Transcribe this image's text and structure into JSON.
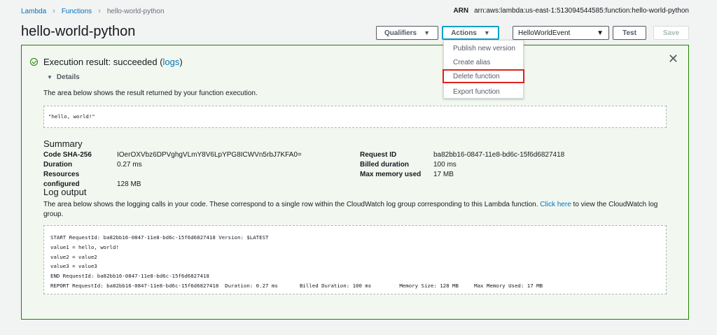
{
  "breadcrumb": [
    "Lambda",
    "Functions",
    "hello-world-python"
  ],
  "arn": {
    "label": "ARN",
    "value": "arn:aws:lambda:us-east-1:513094544585:function:hello-world-python"
  },
  "title": "hello-world-python",
  "header": {
    "qualifiers_label": "Qualifiers",
    "actions_label": "Actions",
    "event_selected": "HelloWorldEvent",
    "test_label": "Test",
    "save_label": "Save"
  },
  "actions_menu": [
    "Publish new version",
    "Create alias",
    "Delete function",
    "Export function"
  ],
  "result": {
    "heading_prefix": "Execution result: succeeded (",
    "logs_link": "logs",
    "heading_suffix": ")",
    "details_label": "Details",
    "description": "The area below shows the result returned by your function execution.",
    "output": "\"hello, world!\""
  },
  "summary": {
    "title": "Summary",
    "left": [
      {
        "k": "Code SHA-256",
        "v": "IOerOXVbz6DPVghgVLmY8V6LpYPG8ICWVn5rbJ7KFA0="
      },
      {
        "k": "Duration",
        "v": "0.27 ms"
      },
      {
        "k": "Resources configured",
        "v": "128 MB"
      }
    ],
    "right": [
      {
        "k": "Request ID",
        "v": "ba82bb16-0847-11e8-bd6c-15f6d6827418"
      },
      {
        "k": "Billed duration",
        "v": "100 ms"
      },
      {
        "k": "Max memory used",
        "v": "17 MB"
      }
    ]
  },
  "log": {
    "title": "Log output",
    "desc_prefix": "The area below shows the logging calls in your code. These correspond to a single row within the CloudWatch log group corresponding to this Lambda function. ",
    "click_here": "Click here",
    "desc_suffix": " to view the CloudWatch log group.",
    "lines": [
      "START RequestId: ba82bb16-0847-11e8-bd6c-15f6d6827418 Version: $LATEST",
      "value1 = hello, world!",
      "value2 = value2",
      "value3 = value3",
      "END RequestId: ba82bb16-0847-11e8-bd6c-15f6d6827418",
      "REPORT RequestId: ba82bb16-0847-11e8-bd6c-15f6d6827418  Duration: 0.27 ms       Billed Duration: 100 ms         Memory Size: 128 MB     Max Memory Used: 17 MB"
    ]
  },
  "icons": {
    "success": "check-circle-icon",
    "close": "close-icon",
    "caret": "caret-down-icon",
    "chevron": "chevron-right-icon"
  },
  "colors": {
    "success": "#1d8102",
    "link": "#0073bb",
    "highlight": "#e02020",
    "focus": "#00a1c9"
  }
}
